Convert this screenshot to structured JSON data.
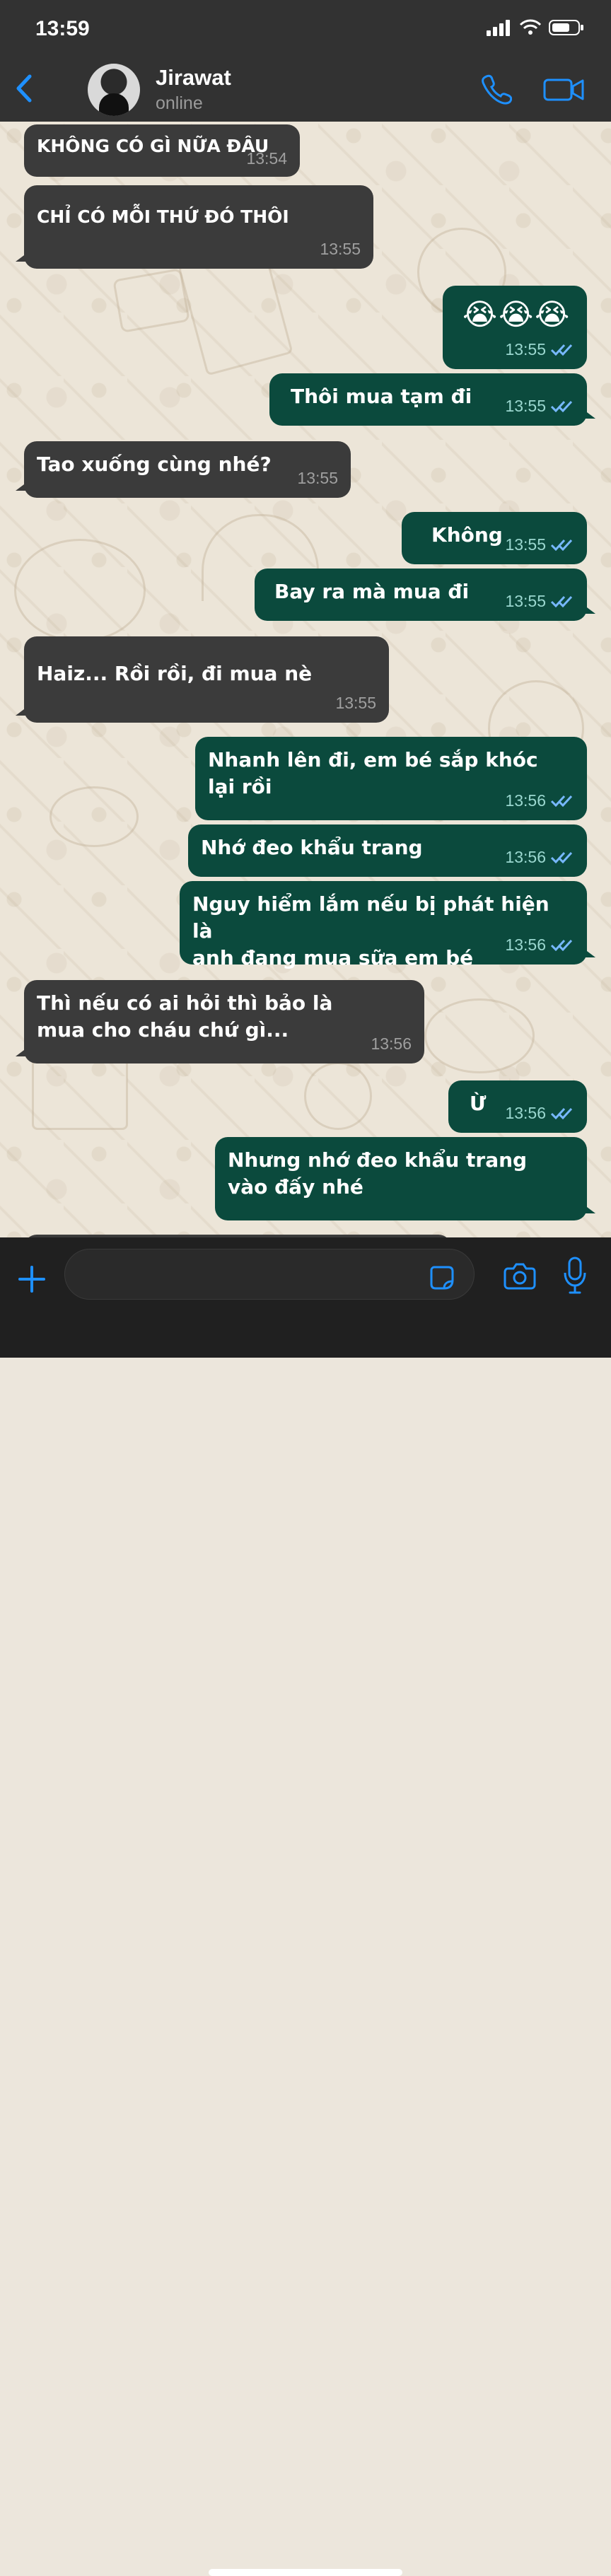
{
  "status_bar": {
    "time": "13:59"
  },
  "header": {
    "contact_name": "Jirawat",
    "contact_status": "online"
  },
  "messages": [
    {
      "text": "KHÔNG CÓ GÌ NỮA ĐÂU",
      "time": "13:54",
      "direction": "incoming"
    },
    {
      "text": "CHỈ CÓ MỖI THỨ ĐÓ THÔI",
      "time": "13:55",
      "direction": "incoming"
    },
    {
      "text": "😭😭😭",
      "time": "13:55",
      "direction": "outgoing"
    },
    {
      "text": "Thôi mua tạm đi",
      "time": "13:55",
      "direction": "outgoing"
    },
    {
      "text": "Tao xuống cùng nhé?",
      "time": "13:55",
      "direction": "incoming"
    },
    {
      "text": "Không",
      "time": "13:55",
      "direction": "outgoing"
    },
    {
      "text": "Bay ra mà mua đi",
      "time": "13:55",
      "direction": "outgoing"
    },
    {
      "text": "Haiz... Rồi rồi, đi mua nè",
      "time": "13:55",
      "direction": "incoming"
    },
    {
      "text": "Nhanh lên đi, em bé sắp khóc\nlại rồi",
      "time": "13:56",
      "direction": "outgoing"
    },
    {
      "text": "Nhớ đeo khẩu trang",
      "time": "13:56",
      "direction": "outgoing"
    },
    {
      "text": "Nguy hiểm lắm nếu bị phát hiện là\nanh đang mua sữa em bé",
      "time": "13:56",
      "direction": "outgoing"
    },
    {
      "text": "Thì nếu có ai hỏi thì bảo là\nmua cho cháu chứ gì...",
      "time": "13:56",
      "direction": "incoming"
    },
    {
      "text": "Ừ",
      "time": "13:56",
      "direction": "outgoing"
    },
    {
      "text": "Nhưng nhớ đeo khẩu trang\nvào đấy nhé",
      "time": "",
      "direction": "outgoing"
    }
  ],
  "composer": {
    "placeholder": ""
  },
  "theme": {
    "accent": "#1e90ff",
    "incoming_bubble": "#3b3b3b",
    "outgoing_bubble": "#0b4a3d"
  }
}
